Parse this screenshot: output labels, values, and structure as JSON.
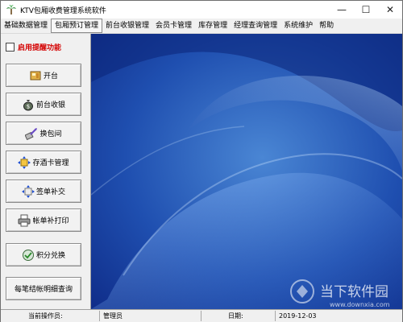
{
  "window": {
    "title": "KTV包厢收费管理系统软件",
    "minimize_glyph": "—",
    "maximize_glyph": "☐",
    "close_glyph": "✕"
  },
  "menu": {
    "items": [
      "基础数据管理",
      "包厢预订管理",
      "前台收银管理",
      "会员卡管理",
      "库存管理",
      "经理查询管理",
      "系统维护",
      "帮助"
    ],
    "active_index": 1
  },
  "sidebar": {
    "reminder": {
      "label": "启用提醒功能",
      "checked": false
    },
    "buttons": [
      {
        "label": "开台",
        "icon": "desk-icon"
      },
      {
        "label": "前台收银",
        "icon": "money-bag-icon"
      },
      {
        "label": "换包间",
        "icon": "exchange-icon"
      },
      {
        "label": "存酒卡管理",
        "icon": "wine-card-icon"
      },
      {
        "label": "签单补交",
        "icon": "sign-bill-icon"
      },
      {
        "label": "帐单补打印",
        "icon": "printer-icon"
      },
      {
        "label": "积分兑换",
        "icon": "points-icon"
      },
      {
        "label": "每笔结帐明细查询",
        "icon": ""
      }
    ]
  },
  "statusbar": {
    "operator_label": "当前操作员:",
    "operator_value": "管理员",
    "date_label": "日期:",
    "date_value": "2019-12-03"
  },
  "watermark": {
    "name": "当下软件园",
    "url": "www.downxia.com"
  },
  "colors": {
    "wallpaper_dark": "#0e2a86",
    "wallpaper_light": "#4a86d4",
    "reminder_text": "#d40000"
  }
}
